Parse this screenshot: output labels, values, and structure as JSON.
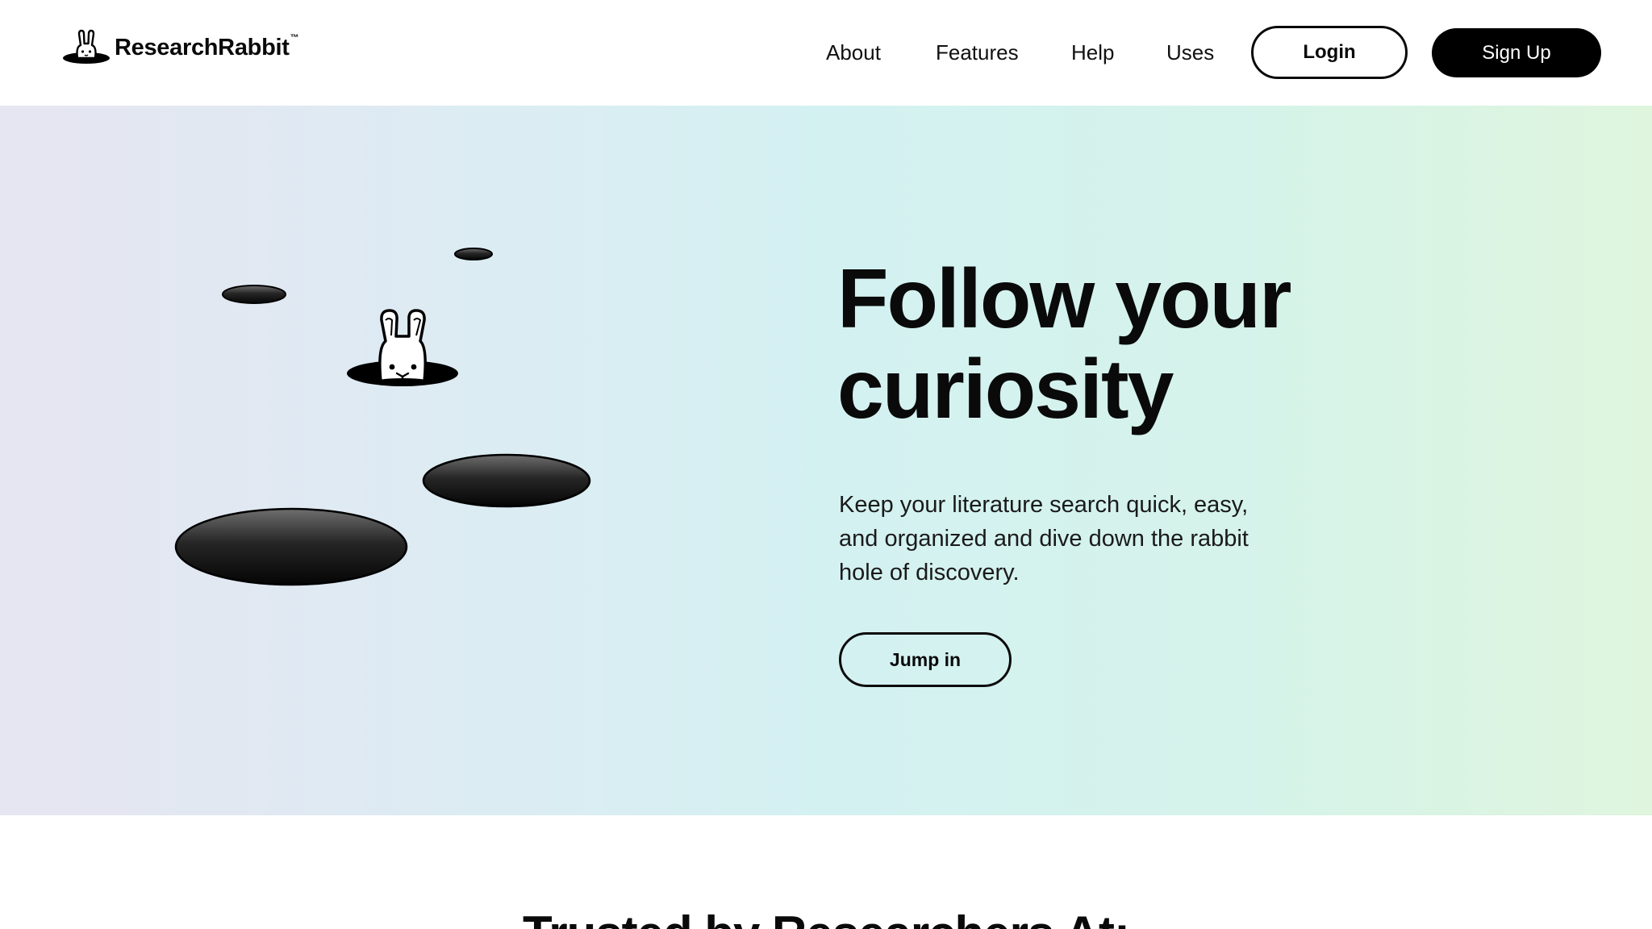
{
  "header": {
    "logo_text": "ResearchRabbit",
    "logo_tm": "™",
    "nav": [
      {
        "label": "About"
      },
      {
        "label": "Features"
      },
      {
        "label": "Help"
      },
      {
        "label": "Uses"
      }
    ],
    "login_label": "Login",
    "signup_label": "Sign Up"
  },
  "hero": {
    "title_line1": "Follow your",
    "title_line2": "curiosity",
    "subtitle": "Keep your literature search quick, easy, and organized and dive down the rabbit hole of discovery.",
    "cta_label": "Jump in"
  },
  "trusted": {
    "title": "Trusted by Researchers At:"
  },
  "colors": {
    "primary": "#000000",
    "background": "#ffffff",
    "hero_gradient_start": "#e6e5f2",
    "hero_gradient_mid": "#d4f1f2",
    "hero_gradient_end": "#dff5de"
  },
  "icons": {
    "logo": "rabbit-in-hole-icon",
    "hero_illustration": "rabbit-holes-illustration"
  }
}
